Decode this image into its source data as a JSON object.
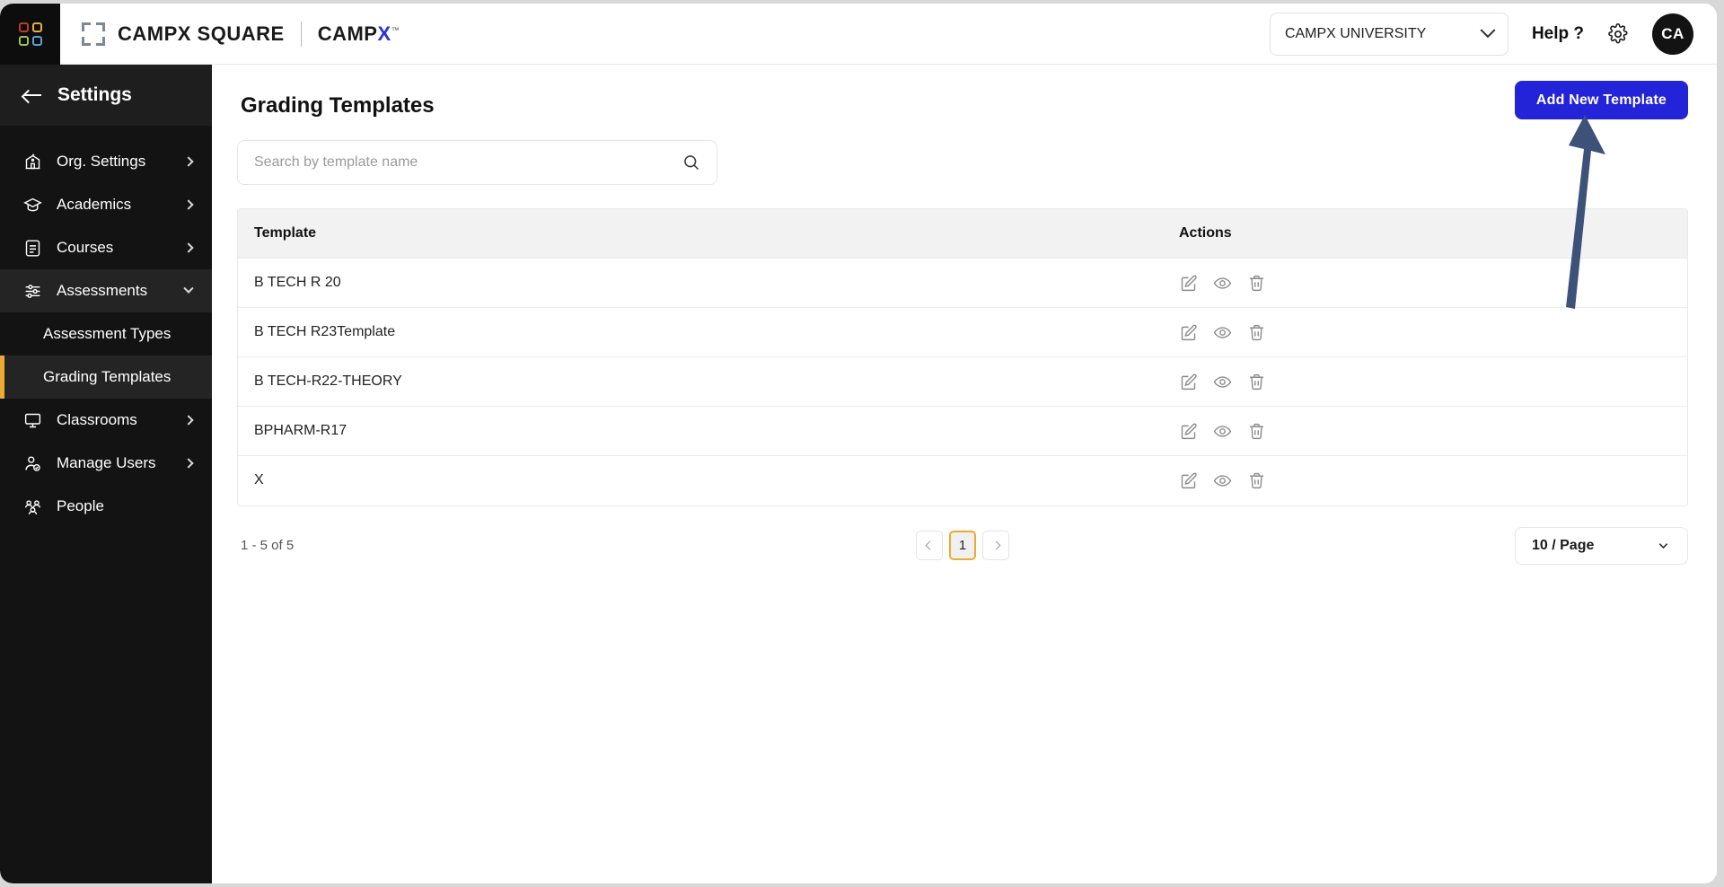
{
  "header": {
    "logo_icon": "four-squares-logo-icon",
    "logo_colors": [
      "#c0392b",
      "#e3b23c",
      "#9dbf5a",
      "#5a9fd4"
    ],
    "bracket_icon": "corner-brackets-icon",
    "brand_square": "CAMPX SQUARE",
    "brand_campx_prefix": "CAMP",
    "brand_campx_x": "X",
    "brand_campx_tm": "™",
    "org_selector": {
      "value": "CAMPX UNIVERSITY",
      "icon": "chevron-down-icon"
    },
    "help_label": "Help ?",
    "settings_icon": "gear-icon",
    "avatar_initials": "CA"
  },
  "sidebar": {
    "back_icon": "arrow-left-icon",
    "title": "Settings",
    "items": [
      {
        "label": "Org. Settings",
        "icon": "school-building-icon",
        "caret": "chevron-right-icon",
        "state": "collapsed"
      },
      {
        "label": "Academics",
        "icon": "graduation-cap-icon",
        "caret": "chevron-right-icon",
        "state": "collapsed"
      },
      {
        "label": "Courses",
        "icon": "document-icon",
        "caret": "chevron-right-icon",
        "state": "collapsed"
      },
      {
        "label": "Assessments",
        "icon": "sliders-icon",
        "caret": "chevron-down-icon",
        "state": "expanded"
      }
    ],
    "sub_items": [
      {
        "label": "Assessment Types",
        "selected": false
      },
      {
        "label": "Grading Templates",
        "selected": true
      }
    ],
    "items_after": [
      {
        "label": "Classrooms",
        "icon": "monitor-icon",
        "caret": "chevron-right-icon",
        "state": "collapsed"
      },
      {
        "label": "Manage Users",
        "icon": "user-check-icon",
        "caret": "chevron-right-icon",
        "state": "collapsed"
      },
      {
        "label": "People",
        "icon": "people-group-icon",
        "caret": "",
        "state": "none"
      }
    ],
    "active_accent": "#edaa33"
  },
  "main": {
    "page_title": "Grading Templates",
    "search": {
      "placeholder": "Search by template name",
      "value": "",
      "icon": "search-icon"
    },
    "add_button": {
      "label": "Add New Template",
      "color": "#2323d8"
    },
    "table": {
      "columns": [
        "Template",
        "Actions"
      ],
      "rows": [
        {
          "template": "B TECH R 20"
        },
        {
          "template": "B TECH R23Template"
        },
        {
          "template": "B TECH-R22-THEORY"
        },
        {
          "template": "BPHARM-R17"
        },
        {
          "template": "X"
        }
      ],
      "row_actions": [
        {
          "name": "edit-icon",
          "title": "Edit"
        },
        {
          "name": "eye-icon",
          "title": "View"
        },
        {
          "name": "trash-icon",
          "title": "Delete"
        }
      ]
    },
    "footer": {
      "count_text": "1 - 5 of 5",
      "prev_icon": "chevron-left-icon",
      "next_icon": "chevron-right-icon",
      "pages": [
        "1"
      ],
      "current_page": "1",
      "page_size_label": "10 / Page",
      "page_size_icon": "chevron-down-icon"
    }
  },
  "annotation": {
    "arrow_icon": "up-arrow-annotation",
    "color": "#3e5party"
  }
}
